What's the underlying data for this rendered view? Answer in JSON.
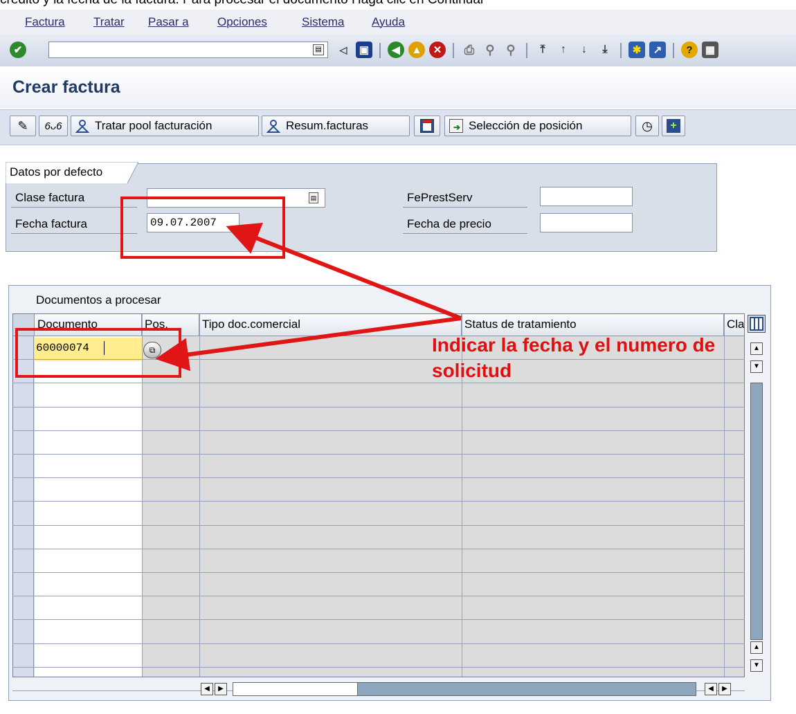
{
  "cropped_text": "crédito y la fecha de la factura. Para procesar el documento Haga clic en Continuar",
  "menu": [
    "Factura",
    "Tratar",
    "Pasar a",
    "Opciones",
    "Sistema",
    "Ayuda"
  ],
  "page_title": "Crear factura",
  "app_toolbar": {
    "btn_tratar_pool": "Tratar pool facturación",
    "btn_resum": "Resum.facturas",
    "btn_seleccion": "Selección de posición"
  },
  "defaults": {
    "tab_label": "Datos por defecto",
    "clase_factura_label": "Clase factura",
    "clase_factura_value": "",
    "fecha_factura_label": "Fecha factura",
    "fecha_factura_value": "09.07.2007",
    "fe_prest_serv_label": "FePrestServ",
    "fe_prest_serv_value": "",
    "fecha_precio_label": "Fecha de precio",
    "fecha_precio_value": ""
  },
  "table": {
    "caption": "Documentos a procesar",
    "columns": [
      "Documento",
      "Pos.",
      "Tipo doc.comercial",
      "Status de tratamiento",
      "Cla"
    ],
    "first_doc": "60000074"
  },
  "annotation": "Indicar la fecha y el numero de solicitud",
  "colors": {
    "annotation_red": "#e01515",
    "title_blue": "#1f3a64",
    "highlight_yellow": "#ffed8f"
  }
}
